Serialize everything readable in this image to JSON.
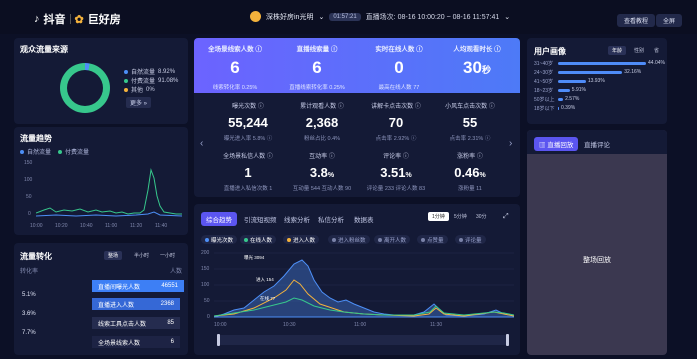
{
  "header": {
    "brand": "抖音",
    "brand2": "巨好房",
    "room_name": "深株好房in光明",
    "room_time": "01:57:21",
    "session": "直播场次: 08-16 10:00:20 ~ 08-16 11:57:41",
    "btn_tutorial": "查看教程",
    "btn_fullscreen": "全屏"
  },
  "source": {
    "title": "观众流量来源",
    "legend": [
      {
        "label": "自然流量",
        "value": "8.92%",
        "color": "#4d8ff7"
      },
      {
        "label": "付费流量",
        "value": "91.08%",
        "color": "#37c78c"
      },
      {
        "label": "其他",
        "value": "0%",
        "color": "#f4b23c"
      }
    ],
    "more": "更多 »"
  },
  "trend": {
    "title": "流量趋势",
    "legend": [
      {
        "label": "自然流量",
        "color": "#4d8ff7"
      },
      {
        "label": "付费流量",
        "color": "#37c78c"
      }
    ],
    "y_ticks": [
      "150",
      "100",
      "50",
      "0"
    ],
    "x_ticks": [
      "10:00",
      "10:20",
      "10:40",
      "11:00",
      "11:20",
      "11:40"
    ]
  },
  "hero": [
    {
      "label": "全场景线索人数 ⓘ",
      "value": "6",
      "sub": "线索转化率 0.25%"
    },
    {
      "label": "直播线索量 ⓘ",
      "value": "6",
      "sub": "直播线索转化率 0.25%"
    },
    {
      "label": "实时在线人数 ⓘ",
      "value": "0",
      "sub": "最高在线人数 77"
    },
    {
      "label": "人均观看时长 ⓘ",
      "value": "30",
      "unit": "秒",
      "sub": ""
    }
  ],
  "metrics_row1": [
    {
      "label": "曝光次数 ⓘ",
      "value": "55,244",
      "sub": "曝光进入率 5.8% ⓘ"
    },
    {
      "label": "累计观看人数 ⓘ",
      "value": "2,368",
      "sub": "粉丝占比 0.4%"
    },
    {
      "label": "讲解卡点击次数 ⓘ",
      "value": "70",
      "sub": "点击率 2.92% ⓘ"
    },
    {
      "label": "小风车点击次数 ⓘ",
      "value": "55",
      "sub": "点击率 2.31% ⓘ"
    }
  ],
  "metrics_row2": [
    {
      "label": "全场景私信人数 ⓘ",
      "value": "1",
      "unit": "",
      "sub": "直播进入私信次数 1"
    },
    {
      "label": "互动率 ⓘ",
      "value": "3.8",
      "unit": "%",
      "sub": "互动量 544  互动人数 90"
    },
    {
      "label": "评论率 ⓘ",
      "value": "3.51",
      "unit": "%",
      "sub": "评论量 233  评论人数 83"
    },
    {
      "label": "涨粉率 ⓘ",
      "value": "0.46",
      "unit": "%",
      "sub": "涨粉量 11"
    }
  ],
  "tabs": [
    "综合趋势",
    "引流短视频",
    "线索分析",
    "私信分析",
    "数据表"
  ],
  "segments": [
    "1分钟",
    "5分钟",
    "30分"
  ],
  "chips": [
    {
      "label": "曝光次数",
      "color": "#4d8ff7",
      "on": true
    },
    {
      "label": "在线人数",
      "color": "#37c78c",
      "on": true
    },
    {
      "label": "进入人数",
      "color": "#f4b23c",
      "on": true
    },
    {
      "label": "进入粉丝数",
      "color": "#7a82a8",
      "on": false
    },
    {
      "label": "离开人数",
      "color": "#7a82a8",
      "on": false
    },
    {
      "label": "点赞量",
      "color": "#7a82a8",
      "on": false
    },
    {
      "label": "评论量",
      "color": "#7a82a8",
      "on": false
    }
  ],
  "main_chart": {
    "y_ticks": [
      "200",
      "150",
      "100",
      "50",
      "0"
    ],
    "x_ticks": [
      "10:00",
      "10:30",
      "11:00",
      "11:30"
    ],
    "annotations": [
      "曝光 3094",
      "进入 154",
      "在线 77"
    ]
  },
  "conversion": {
    "title": "流量转化",
    "tabs": [
      "整场",
      "半小时",
      "一小时"
    ],
    "col_left": "转化率",
    "col_right": "人数",
    "rates": [
      "5.1%",
      "3.6%",
      "7.7%"
    ],
    "rows": [
      {
        "label": "直播间曝光人数",
        "value": "46551"
      },
      {
        "label": "直播进入人数",
        "value": "2368"
      },
      {
        "label": "线索工具点击人数",
        "value": "85"
      },
      {
        "label": "全场景线索人数",
        "value": "6"
      }
    ]
  },
  "portrait": {
    "title": "用户画像",
    "tabs": [
      "年龄",
      "性别",
      "省"
    ],
    "bars": [
      {
        "label": "31~40岁",
        "value": "44.04%",
        "pct": 44.04
      },
      {
        "label": "24~30岁",
        "value": "32.16%",
        "pct": 32.16
      },
      {
        "label": "41~50岁",
        "value": "13.93%",
        "pct": 13.93
      },
      {
        "label": "18~23岁",
        "value": "5.91%",
        "pct": 5.91
      },
      {
        "label": "50岁以上",
        "value": "2.57%",
        "pct": 2.57
      },
      {
        "label": "18岁以下",
        "value": "0.39%",
        "pct": 0.39
      }
    ]
  },
  "replay": {
    "tabs": [
      "直播回放",
      "直播评论"
    ],
    "caption": "整场回放"
  }
}
